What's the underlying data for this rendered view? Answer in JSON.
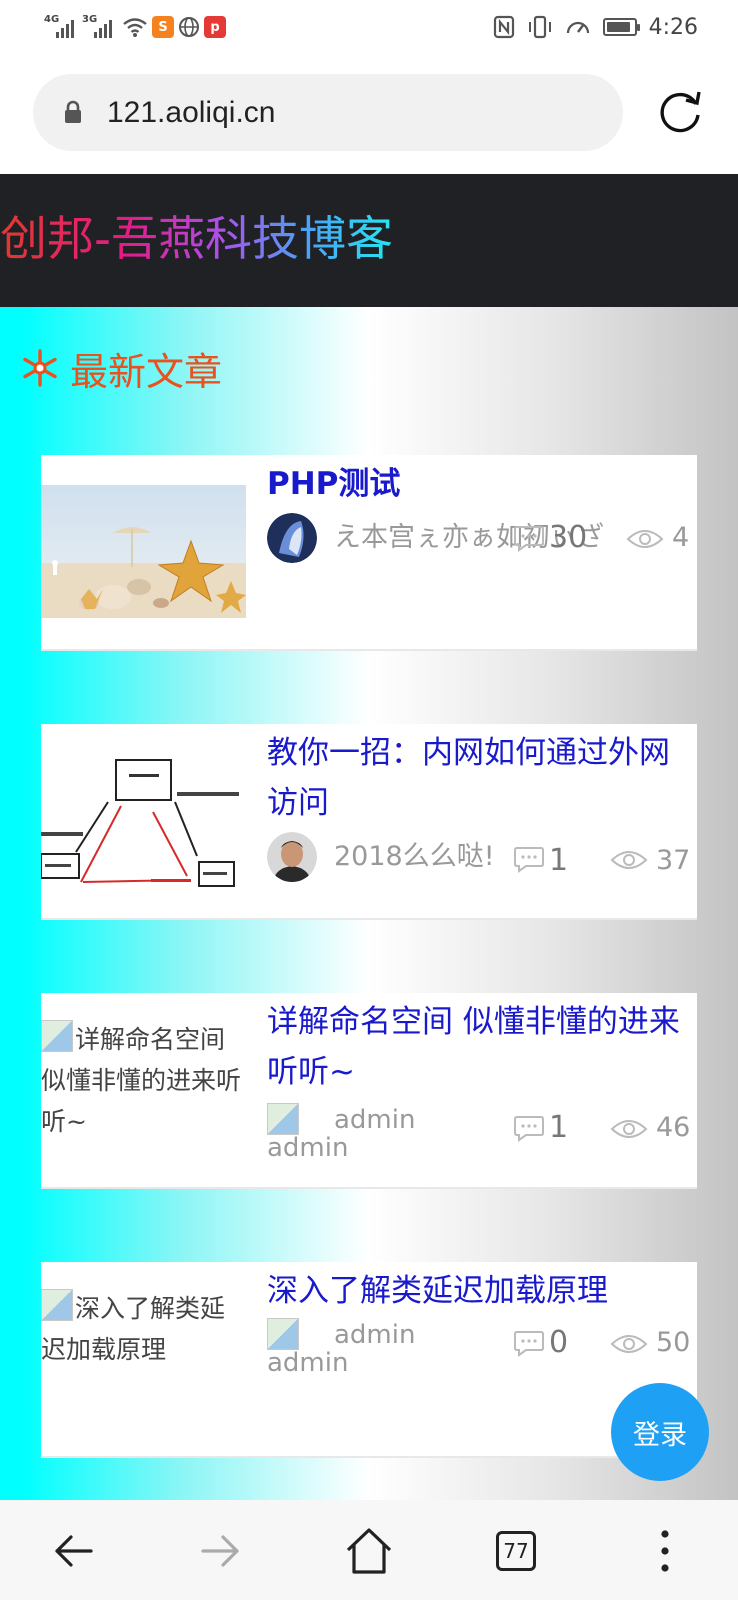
{
  "status_bar": {
    "network_1": "4G",
    "network_2": "3G",
    "time": "4:26",
    "icons": [
      "signal-icon",
      "signal-icon",
      "wifi-icon",
      "app-icon",
      "globe-icon",
      "app-icon",
      "nfc-icon",
      "vibrate-icon",
      "speed-icon",
      "battery-icon"
    ],
    "battery_level": 0.9
  },
  "browser": {
    "url": "121.aoliqi.cn",
    "tab_count": "77",
    "icons": [
      "lock-icon",
      "reload-icon",
      "back-icon",
      "forward-icon",
      "home-icon",
      "tabs-icon",
      "more-icon"
    ]
  },
  "site": {
    "title": "创邦-吾燕科技博客",
    "section_title": "最新文章",
    "section_icon": "snowflake-icon"
  },
  "posts": [
    {
      "title": "PHP测试",
      "author": "え本宫ぇ亦ぁ如初ぃざ",
      "comments": "30",
      "views": "4"
    },
    {
      "title": "教你一招：内网如何通过外网访问",
      "author": "2018么么哒!",
      "comments": "1",
      "views": "37"
    },
    {
      "title": "详解命名空间 似懂非懂的进来听听~",
      "thumb_alt": "详解命名空间 似懂非懂的进来听听~",
      "author": "admin",
      "avatar_alt": "admin",
      "comments": "1",
      "views": "46"
    },
    {
      "title": "深入了解类延迟加载原理",
      "thumb_alt": "深入了解类延迟加载原理",
      "author": "admin",
      "avatar_alt": "admin",
      "comments": "0",
      "views": "50"
    }
  ],
  "login_button": "登录",
  "colors": {
    "header_bg": "#202124",
    "title_link": "#1a1acd",
    "section_title": "#e8521e",
    "login_bg": "#1ea0f5"
  }
}
